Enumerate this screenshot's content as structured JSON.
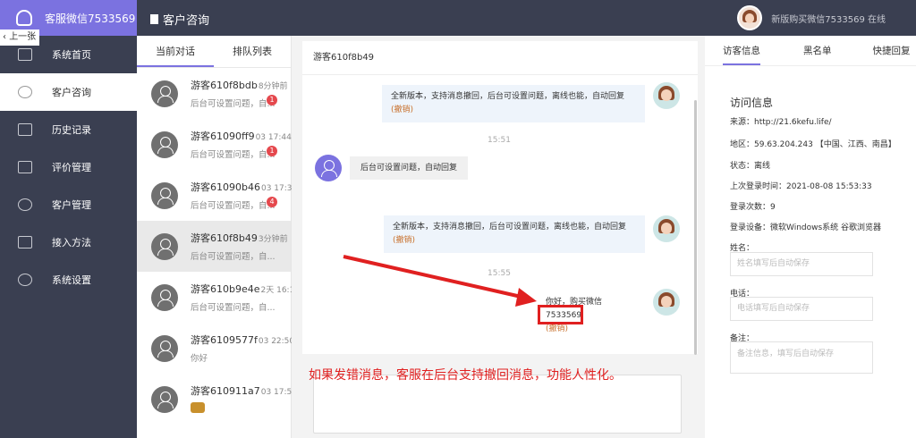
{
  "brand": {
    "title": "客服微信7533569"
  },
  "back_button": "上一张",
  "header": {
    "title": "客户咨询",
    "user_text": "新版购买微信7533569 在线"
  },
  "sidebar": {
    "items": [
      {
        "label": "系统首页"
      },
      {
        "label": "客户咨询"
      },
      {
        "label": "历史记录"
      },
      {
        "label": "评价管理"
      },
      {
        "label": "客户管理"
      },
      {
        "label": "接入方法"
      },
      {
        "label": "系统设置"
      }
    ]
  },
  "conv_tabs": [
    "当前对话",
    "排队列表"
  ],
  "conversations": [
    {
      "name": "游客610f8bdb",
      "time": "8分钟前",
      "msg": "后台可设置问题，自...",
      "badge": "1"
    },
    {
      "name": "游客61090ff9",
      "time": "03 17:44",
      "msg": "后台可设置问题，自...",
      "badge": "1"
    },
    {
      "name": "游客61090b46",
      "time": "03 17:38",
      "msg": "后台可设置问题，自...",
      "badge": "4"
    },
    {
      "name": "游客610f8b49",
      "time": "3分钟前",
      "msg": "后台可设置问题，自...",
      "badge": ""
    },
    {
      "name": "游客610b9e4e",
      "time": "2天 16:16",
      "msg": "后台可设置问题，自...",
      "badge": ""
    },
    {
      "name": "游客6109577f",
      "time": "03 22:50",
      "msg": "你好",
      "badge": ""
    },
    {
      "name": "游客610911a7",
      "time": "03 17:51",
      "msg": "",
      "badge": ""
    }
  ],
  "chat": {
    "header": "游客610f8b49",
    "msg1_text": "全新版本，支持消息撤回，后台可设置问题，离线也能，自动回复",
    "recall_label": "(撤销)",
    "time1": "15:51",
    "visitor_msg": "后台可设置问题，自动回复",
    "msg2_text": "全新版本，支持消息撤回，后台可设置问题，离线也能，自动回复",
    "time2": "15:55",
    "msg3_text": "你好，购买微信7533569",
    "annotation": "如果发错消息，客服在后台支持撤回消息，功能人性化。"
  },
  "info": {
    "tabs": [
      "访客信息",
      "黑名单",
      "快捷回复"
    ],
    "title": "访问信息",
    "source": "来源：http://21.6kefu.life/",
    "region": "地区：59.63.204.243 【中国、江西、南昌】",
    "status": "状态：离线",
    "last_login": "上次登录时间：2021-08-08 15:53:33",
    "login_count": "登录次数：9",
    "device": "登录设备：微软Windows系统 谷歌浏览器",
    "name_label": "姓名：",
    "name_placeholder": "姓名填写后自动保存",
    "phone_label": "电话：",
    "phone_placeholder": "电话填写后自动保存",
    "note_label": "备注：",
    "note_placeholder": "备注信息，填写后自动保存"
  },
  "colors": {
    "accent": "#7b72e0",
    "sidebar": "#3a3f51",
    "annotation": "#e02020"
  }
}
